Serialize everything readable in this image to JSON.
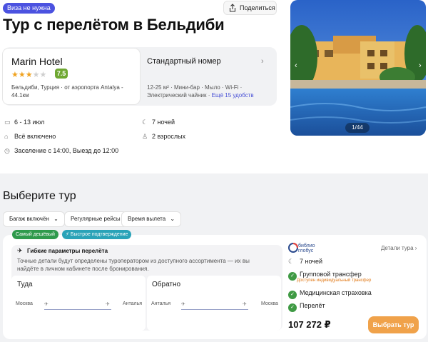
{
  "header": {
    "visa_badge": "Виза не нужна",
    "share_label": "Поделиться",
    "title": "Тур с перелётом в Бельдиби"
  },
  "hotel": {
    "name": "Marin Hotel",
    "stars_filled": 3,
    "stars_total": 5,
    "rating": "7.5",
    "location": "Бельдиби, Турция · от аэропорта Antalya - 44.1км"
  },
  "room": {
    "title": "Стандартный номер",
    "description": "12-25 м² · Мини-бар · Мыло · Wi-Fi · Электрический чайник ·",
    "more_link": "Ещё 15 удобств"
  },
  "trip": {
    "dates": "6 - 13 июл",
    "nights": "7 ночей",
    "meals": "Всё включено",
    "guests": "2 взрослых",
    "checkin": "Заселение с 14:00, Выезд до 12:00"
  },
  "gallery": {
    "counter": "1/44"
  },
  "tours": {
    "section_title": "Выберите тур",
    "filters": [
      "Багаж включён",
      "Регулярные рейсы",
      "Время вылета"
    ],
    "tags": [
      {
        "label": "Самый дешёвый",
        "color": "#2f9a4c"
      },
      {
        "label": "⚡ Быстрое подтверждение",
        "color": "#2aa3b8"
      }
    ],
    "flight": {
      "title": "Гибкие параметры перелёта",
      "description": "Точные детали будут определены туроператором из доступного ассортимента — их вы найдёте в личном кабинете после бронирования.",
      "outbound": {
        "label": "Туда",
        "from": "Москва",
        "to": "Анталья"
      },
      "return": {
        "label": "Обратно",
        "from": "Анталья",
        "to": "Москва"
      }
    },
    "operator": {
      "name_line1": "библио",
      "name_line2": "глобус",
      "details_link": "Детали тура"
    },
    "features": {
      "nights": "7 ночей",
      "transfer": "Групповой трансфер",
      "transfer_note": "Доступен индивидуальный трансфер",
      "insurance": "Медицинская страховка",
      "flight": "Перелёт"
    },
    "price": "107 272 ₽",
    "book_label": "Выбрать тур"
  },
  "colors": {
    "accent": "#4b52e0",
    "book_button": "#f0a24a",
    "check_green": "#3f9a44",
    "rating_green": "#6fa832",
    "transfer_orange": "#e17a18"
  }
}
